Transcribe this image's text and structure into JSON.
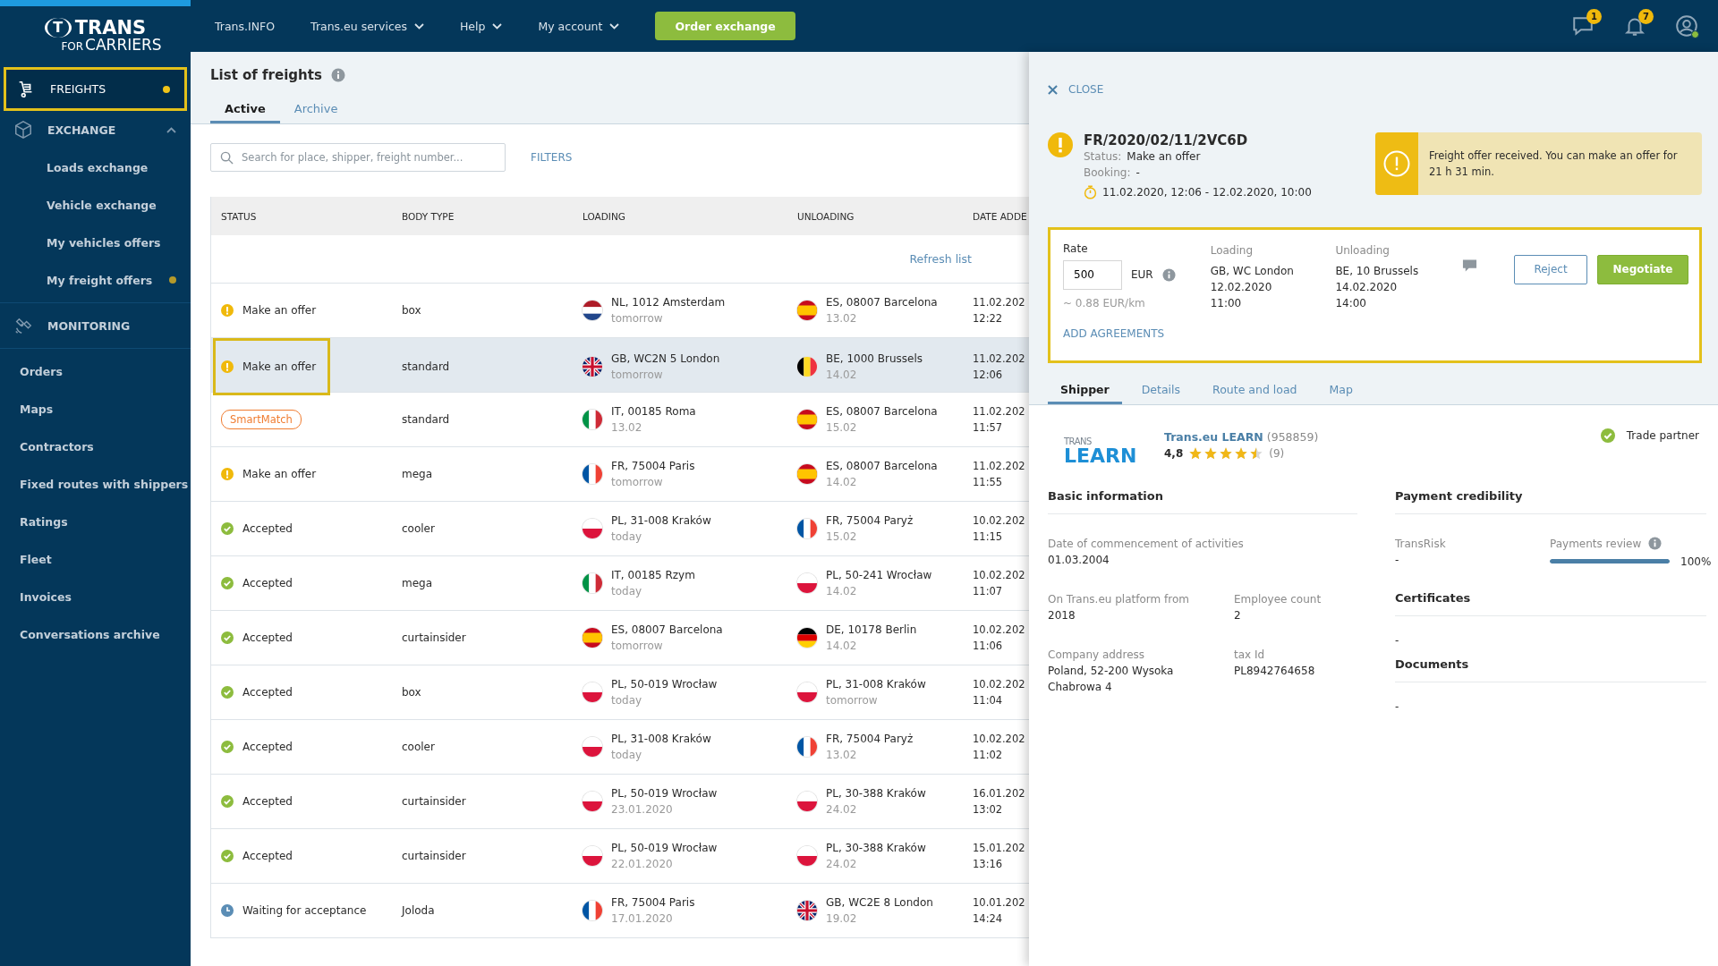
{
  "sidebar": {
    "logo": {
      "mark": "T",
      "word": "TRANS",
      "sub_a": "FOR",
      "sub_b": "CARRIERS"
    },
    "sections": [
      {
        "label": "FREIGHTS",
        "selected": true,
        "dot": true
      },
      {
        "label": "EXCHANGE",
        "selected": false,
        "expanded": true,
        "children": [
          {
            "label": "Loads exchange",
            "dot": false
          },
          {
            "label": "Vehicle exchange",
            "dot": false
          },
          {
            "label": "My vehicles offers",
            "dot": false
          },
          {
            "label": "My freight offers",
            "dot": true
          }
        ]
      },
      {
        "label": "MONITORING",
        "selected": false,
        "dot": false
      }
    ],
    "links": [
      "Orders",
      "Maps",
      "Contractors",
      "Fixed routes with shippers",
      "Ratings",
      "Fleet",
      "Invoices",
      "Conversations archive"
    ]
  },
  "topbar": {
    "links": [
      {
        "label": "Trans.INFO",
        "dropdown": false
      },
      {
        "label": "Trans.eu services",
        "dropdown": true
      },
      {
        "label": "Help",
        "dropdown": true
      },
      {
        "label": "My account",
        "dropdown": true
      }
    ],
    "order_button": "Order exchange",
    "icons": [
      {
        "kind": "chat",
        "badge": "1"
      },
      {
        "kind": "bell",
        "badge": "7"
      },
      {
        "kind": "user",
        "online": true
      }
    ]
  },
  "main": {
    "title": "List of freights",
    "tabs": [
      {
        "label": "Active",
        "selected": true
      },
      {
        "label": "Archive",
        "selected": false
      }
    ],
    "search": {
      "placeholder": "Search for place, shipper, freight number..."
    },
    "filters": "FILTERS",
    "table": {
      "columns": [
        "STATUS",
        "BODY TYPE",
        "LOADING",
        "UNLOADING",
        "DATE ADDE"
      ],
      "refresh": "Refresh list",
      "rows": [
        {
          "selected": false,
          "status": {
            "kind": "offer",
            "text": "Make an offer"
          },
          "body": "box",
          "loading": {
            "place": "NL, 1012 Amsterdam",
            "date": "tomorrow"
          },
          "unloading": {
            "place": "ES, 08007 Barcelona",
            "date": "13.02"
          },
          "added": [
            "11.02.202",
            "12:22"
          ]
        },
        {
          "selected": true,
          "status": {
            "kind": "offer",
            "text": "Make an offer"
          },
          "body": "standard",
          "loading": {
            "place": "GB, WC2N 5 London",
            "date": "tomorrow"
          },
          "unloading": {
            "place": "BE, 1000 Brussels",
            "date": "14.02"
          },
          "added": [
            "11.02.202",
            "12:06"
          ]
        },
        {
          "selected": false,
          "status": {
            "kind": "smartmatch",
            "text": "SmartMatch"
          },
          "body": "standard",
          "loading": {
            "place": "IT, 00185 Roma",
            "date": "13.02"
          },
          "unloading": {
            "place": "ES, 08007 Barcelona",
            "date": "15.02"
          },
          "added": [
            "11.02.202",
            "11:57"
          ]
        },
        {
          "selected": false,
          "status": {
            "kind": "offer",
            "text": "Make an offer"
          },
          "body": "mega",
          "loading": {
            "place": "FR, 75004 Paris",
            "date": "tomorrow"
          },
          "unloading": {
            "place": "ES, 08007 Barcelona",
            "date": "14.02"
          },
          "added": [
            "11.02.202",
            "11:55"
          ]
        },
        {
          "selected": false,
          "status": {
            "kind": "accepted",
            "text": "Accepted"
          },
          "body": "cooler",
          "loading": {
            "place": "PL, 31-008 Kraków",
            "date": "today"
          },
          "unloading": {
            "place": "FR, 75004 Paryż",
            "date": "15.02"
          },
          "added": [
            "10.02.202",
            "11:15"
          ]
        },
        {
          "selected": false,
          "status": {
            "kind": "accepted",
            "text": "Accepted"
          },
          "body": "mega",
          "loading": {
            "place": "IT, 00185 Rzym",
            "date": "today"
          },
          "unloading": {
            "place": "PL, 50-241 Wrocław",
            "date": "14.02"
          },
          "added": [
            "10.02.202",
            "11:07"
          ]
        },
        {
          "selected": false,
          "status": {
            "kind": "accepted",
            "text": "Accepted"
          },
          "body": "curtainsider",
          "loading": {
            "place": "ES, 08007 Barcelona",
            "date": "tomorrow"
          },
          "unloading": {
            "place": "DE, 10178 Berlin",
            "date": "14.02"
          },
          "added": [
            "10.02.202",
            "11:06"
          ]
        },
        {
          "selected": false,
          "status": {
            "kind": "accepted",
            "text": "Accepted"
          },
          "body": "box",
          "loading": {
            "place": "PL, 50-019 Wrocław",
            "date": "today"
          },
          "unloading": {
            "place": "PL, 31-008 Kraków",
            "date": "tomorrow"
          },
          "added": [
            "10.02.202",
            "11:04"
          ]
        },
        {
          "selected": false,
          "status": {
            "kind": "accepted",
            "text": "Accepted"
          },
          "body": "cooler",
          "loading": {
            "place": "PL, 31-008 Kraków",
            "date": "today"
          },
          "unloading": {
            "place": "FR, 75004 Paryż",
            "date": "13.02"
          },
          "added": [
            "10.02.202",
            "11:02"
          ]
        },
        {
          "selected": false,
          "status": {
            "kind": "accepted",
            "text": "Accepted"
          },
          "body": "curtainsider",
          "loading": {
            "place": "PL, 50-019 Wrocław",
            "date": "23.01.2020"
          },
          "unloading": {
            "place": "PL, 30-388 Kraków",
            "date": "24.02"
          },
          "added": [
            "16.01.202",
            "13:02"
          ]
        },
        {
          "selected": false,
          "status": {
            "kind": "accepted",
            "text": "Accepted"
          },
          "body": "curtainsider",
          "loading": {
            "place": "PL, 50-019 Wrocław",
            "date": "22.01.2020"
          },
          "unloading": {
            "place": "PL, 30-388 Kraków",
            "date": "24.02"
          },
          "added": [
            "15.01.202",
            "13:16"
          ]
        },
        {
          "selected": false,
          "status": {
            "kind": "waiting",
            "text": "Waiting for acceptance"
          },
          "body": "Joloda",
          "loading": {
            "place": "FR, 75004 Paris",
            "date": "17.01.2020"
          },
          "unloading": {
            "place": "GB, WC2E 8 London",
            "date": "19.02"
          },
          "added": [
            "10.01.202",
            "14:24"
          ]
        }
      ]
    }
  },
  "panel": {
    "close": "CLOSE",
    "freight": {
      "number": "FR/2020/02/11/2VC6D",
      "status_label": "Status:",
      "status": "Make an offer",
      "booking_label": "Booking:",
      "booking": "-",
      "period": "11.02.2020, 12:06 - 12.02.2020, 10:00"
    },
    "alert": "Freight offer received. You can make an offer for 21 h 31 min.",
    "offer": {
      "rate_label": "Rate",
      "rate": "500",
      "currency": "EUR",
      "per_km": "~ 0.88 EUR/km",
      "places": [
        {
          "label": "Loading",
          "lines": [
            "GB, WC London",
            "12.02.2020",
            "11:00"
          ]
        },
        {
          "label": "Unloading",
          "lines": [
            "BE, 10 Brussels",
            "14.02.2020",
            "14:00"
          ]
        }
      ],
      "reject": "Reject",
      "negotiate": "Negotiate",
      "add_agreements": "ADD AGREEMENTS"
    },
    "tabs": [
      {
        "label": "Shipper",
        "selected": true
      },
      {
        "label": "Details",
        "selected": false
      },
      {
        "label": "Route and load",
        "selected": false
      },
      {
        "label": "Map",
        "selected": false
      }
    ],
    "shipper": {
      "logo_small": "TRANS",
      "logo_big": "LEARN",
      "name": "Trans.eu LEARN",
      "number": "(958859)",
      "rating": "4,8",
      "stars": 4.5,
      "reviews": "(9)",
      "trade_partner": "Trade partner",
      "basic": {
        "title": "Basic information",
        "fields": [
          {
            "label": "Date of commencement of activities",
            "lines": [
              "01.03.2004"
            ]
          },
          {
            "label": "On Trans.eu platform from",
            "lines": [
              "2018"
            ]
          },
          {
            "label": "Employee count",
            "lines": [
              "2"
            ]
          },
          {
            "label": "Company address",
            "lines": [
              "Poland, 52-200 Wysoka",
              "Chabrowa 4"
            ]
          },
          {
            "label": "tax Id",
            "lines": [
              "PL8942764658"
            ]
          }
        ]
      },
      "payment": {
        "title": "Payment credibility",
        "transrisk_label": "TransRisk",
        "transrisk": "-",
        "review_label": "Payments review",
        "level": 1,
        "reading": "100%"
      },
      "sections": [
        {
          "title": "Certificates",
          "value": "-"
        },
        {
          "title": "Documents",
          "value": "-"
        }
      ]
    }
  }
}
